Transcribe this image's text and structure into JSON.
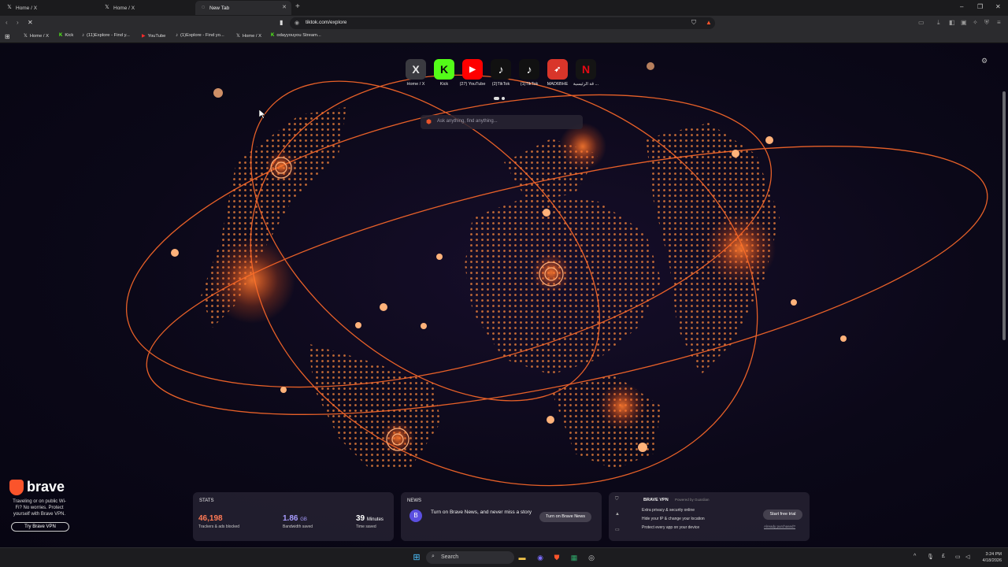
{
  "tabs": [
    {
      "title": "Home / X",
      "icon": "x-logo-icon"
    },
    {
      "title": "Home / X",
      "icon": "x-logo-icon"
    },
    {
      "title": "New Tab",
      "icon": "loading-icon",
      "active": true
    }
  ],
  "address_bar": {
    "url": "tiktok.com/explore"
  },
  "bookmarks": [
    {
      "label": "Home / X",
      "icon": "x-logo-icon"
    },
    {
      "label": "Kick",
      "icon": "kick-icon"
    },
    {
      "label": "(11)Explore - Find y...",
      "icon": "tiktok-icon"
    },
    {
      "label": "YouTube",
      "icon": "youtube-icon"
    },
    {
      "label": "(1)Explore - Find yo...",
      "icon": "tiktok-icon"
    },
    {
      "label": "Home / X",
      "icon": "x-logo-icon"
    },
    {
      "label": "odayyouyou Stream...",
      "icon": "kick-icon"
    }
  ],
  "top_sites": [
    {
      "label": "Home / X",
      "glyph": "X",
      "bg": "#3b3b40",
      "fg": "#ffffff"
    },
    {
      "label": "Kick",
      "glyph": "K",
      "bg": "#53fc18",
      "fg": "#0b0b0b"
    },
    {
      "label": "(27) YouTube",
      "glyph": "▶",
      "bg": "#ff0000",
      "fg": "#ffffff"
    },
    {
      "label": "(2)TikTok",
      "glyph": "♪",
      "bg": "#111111",
      "fg": "#ffffff"
    },
    {
      "label": "(1)TikTok",
      "glyph": "♪",
      "bg": "#111111",
      "fg": "#ffffff"
    },
    {
      "label": "MAD6BHE",
      "glyph": "➶",
      "bg": "#d9352a",
      "fg": "#ffffff"
    },
    {
      "label": "قة الرئيسية ...",
      "glyph": "N",
      "bg": "#141414",
      "fg": "#e50914"
    }
  ],
  "search": {
    "placeholder": "Ask anything, find anything..."
  },
  "promo": {
    "brand": "brave",
    "text": "Traveling or on public Wi-Fi? No worries. Protect yourself with Brave VPN.",
    "button": "Try Brave VPN"
  },
  "stats": {
    "title": "STATS",
    "trackers": {
      "value": "46,198",
      "label": "Trackers & ads blocked"
    },
    "bandwidth": {
      "value": "1.86",
      "unit": "GB",
      "label": "Bandwidth saved"
    },
    "time": {
      "value": "39",
      "unit": "Minutes",
      "label": "Time saved"
    }
  },
  "news": {
    "title": "NEWS",
    "text": "Turn on Brave News, and never miss a story",
    "button": "Turn on Brave News"
  },
  "vpn": {
    "title": "BRAVE VPN",
    "powered": "Powered by Guardian",
    "features": [
      "Extra privacy & security online",
      "Hide your IP & change your location",
      "Protect every app on your device"
    ],
    "button": "Start free trial",
    "link": "Already purchased?"
  },
  "taskbar": {
    "search": "Search",
    "time": "3:24 PM",
    "date": "4/18/2026"
  },
  "colors": {
    "accent": "#fb542b",
    "trackers": "#ff7a55",
    "bandwidth": "#a89cff"
  }
}
